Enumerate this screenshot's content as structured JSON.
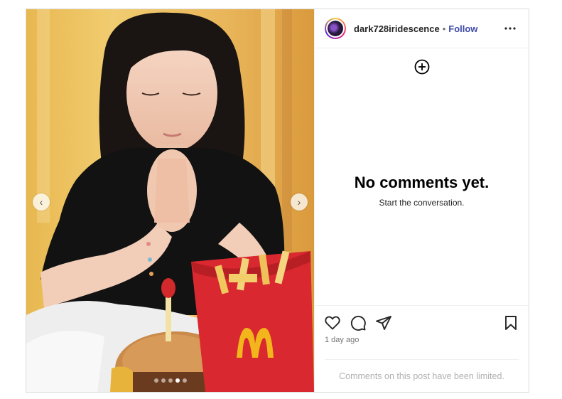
{
  "post": {
    "username": "dark728iridescence",
    "separator": "•",
    "follow_label": "Follow",
    "more_icon": "more-horizontal-icon"
  },
  "media": {
    "description_icons": [
      "chevron-left-icon",
      "chevron-right-icon"
    ],
    "carousel": {
      "count": 5,
      "active_index": 3
    },
    "prev_glyph": "‹",
    "next_glyph": "›"
  },
  "comments": {
    "add_icon": "plus-circle-icon",
    "empty_title": "No comments yet.",
    "empty_subtitle": "Start the conversation."
  },
  "actions": {
    "icons": [
      "heart-icon",
      "comment-icon",
      "share-icon",
      "bookmark-icon"
    ],
    "timestamp": "1 day ago"
  },
  "footer": {
    "limited_text": "Comments on this post have been limited."
  },
  "colors": {
    "follow": "#3f4ba8",
    "border": "#dbdbdb",
    "muted": "#737373"
  }
}
